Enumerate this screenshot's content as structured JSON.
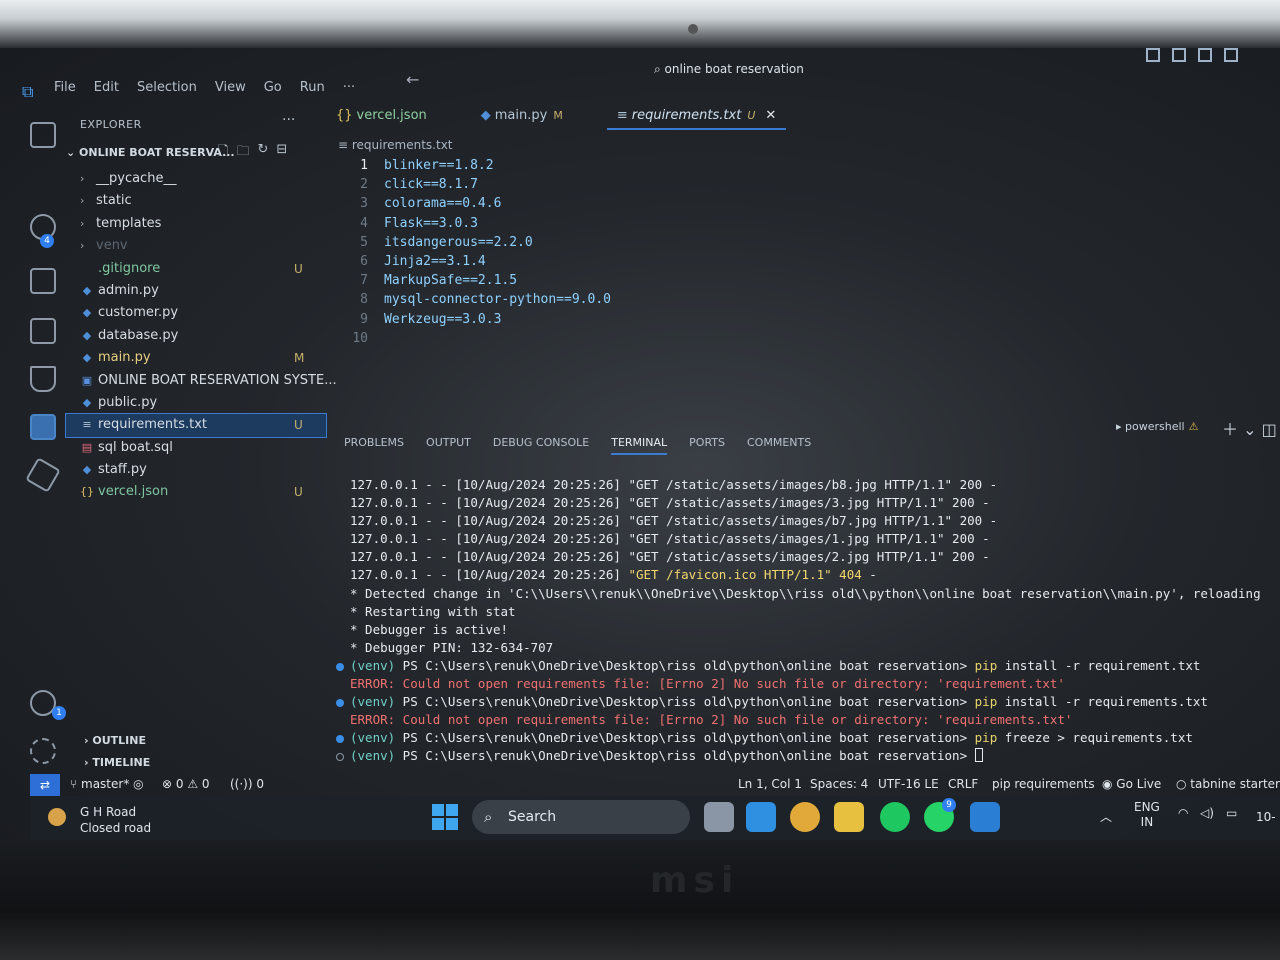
{
  "titlebar": {
    "menu": [
      "File",
      "Edit",
      "Selection",
      "View",
      "Go",
      "Run",
      "···"
    ],
    "command_center": "online boat reservation"
  },
  "explorer": {
    "title": "EXPLORER",
    "dots": "···",
    "root": "ONLINE BOAT RESERVA...",
    "items": [
      {
        "label": "__pycache__",
        "type": "folder",
        "status": ""
      },
      {
        "label": "static",
        "type": "folder",
        "status": ""
      },
      {
        "label": "templates",
        "type": "folder",
        "status": ""
      },
      {
        "label": "venv",
        "type": "folder",
        "status": ""
      },
      {
        "label": ".gitignore",
        "type": "file",
        "status": "U"
      },
      {
        "label": "admin.py",
        "type": "python",
        "status": ""
      },
      {
        "label": "customer.py",
        "type": "python",
        "status": ""
      },
      {
        "label": "database.py",
        "type": "python",
        "status": ""
      },
      {
        "label": "main.py",
        "type": "python",
        "status": "M"
      },
      {
        "label": "ONLINE BOAT RESERVATION SYSTE...",
        "type": "doc",
        "status": ""
      },
      {
        "label": "public.py",
        "type": "python",
        "status": ""
      },
      {
        "label": "requirements.txt",
        "type": "text",
        "status": "U"
      },
      {
        "label": "sql boat.sql",
        "type": "sql",
        "status": ""
      },
      {
        "label": "staff.py",
        "type": "python",
        "status": ""
      },
      {
        "label": "vercel.json",
        "type": "json",
        "status": "U"
      }
    ],
    "outline": "OUTLINE",
    "timeline": "TIMELINE"
  },
  "activity": {
    "scm_badge": "4",
    "accounts_badge": "1"
  },
  "tabs": [
    {
      "label": "vercel.json",
      "icon": "{}",
      "mod": ""
    },
    {
      "label": "main.py",
      "icon": "◆",
      "mod": "M"
    },
    {
      "label": "requirements.txt",
      "icon": "≡",
      "mod": "U"
    }
  ],
  "editor": {
    "breadcrumb": "requirements.txt",
    "lines": [
      "blinker==1.8.2",
      "click==8.1.7",
      "colorama==0.4.6",
      "Flask==3.0.3",
      "itsdangerous==2.2.0",
      "Jinja2==3.1.4",
      "MarkupSafe==2.1.5",
      "mysql-connector-python==9.0.0",
      "Werkzeug==3.0.3",
      ""
    ],
    "line_numbers": [
      "1",
      "2",
      "3",
      "4",
      "5",
      "6",
      "7",
      "8",
      "9",
      "10"
    ]
  },
  "panel": {
    "tabs": [
      "PROBLEMS",
      "OUTPUT",
      "DEBUG CONSOLE",
      "TERMINAL",
      "PORTS",
      "COMMENTS"
    ],
    "active_tab": "TERMINAL",
    "shell": "powershell",
    "plus": "+"
  },
  "terminal": {
    "log_lines": [
      {
        "pre": "127.0.0.1 - - [10/Aug/2024 20:25:26] \"GET /static/assets/images/b8.jpg HTTP/1.1\" 200 -"
      },
      {
        "pre": "127.0.0.1 - - [10/Aug/2024 20:25:26] \"GET /static/assets/images/3.jpg HTTP/1.1\" 200 -"
      },
      {
        "pre": "127.0.0.1 - - [10/Aug/2024 20:25:26] \"GET /static/assets/images/b7.jpg HTTP/1.1\" 200 -"
      },
      {
        "pre": "127.0.0.1 - - [10/Aug/2024 20:25:26] \"GET /static/assets/images/1.jpg HTTP/1.1\" 200 -"
      },
      {
        "pre": "127.0.0.1 - - [10/Aug/2024 20:25:26] \"GET /static/assets/images/2.jpg HTTP/1.1\" 200 -"
      }
    ],
    "favicon_prefix": "127.0.0.1 - - [10/Aug/2024 20:25:26] ",
    "favicon_hl": "\"GET /favicon.ico HTTP/1.1\" 404",
    "favicon_suffix": " -",
    "info_lines": [
      " * Detected change in 'C:\\\\Users\\\\renuk\\\\OneDrive\\\\Desktop\\\\riss  old\\\\python\\\\online boat reservation\\\\main.py', reloading",
      " * Restarting with stat",
      " * Debugger is active!",
      " * Debugger PIN: 132-634-707"
    ],
    "venv": "(venv)",
    "prompt": " PS C:\\Users\\renuk\\OneDrive\\Desktop\\riss  old\\python\\online boat reservation> ",
    "cmd1_pip": "pip",
    "cmd1_rest": " install -r requirement.txt",
    "err1": "ERROR: Could not open requirements file: [Errno 2] No such file or directory: 'requirement.txt'",
    "cmd2_pip": "pip",
    "cmd2_rest": " install -r requirements.txt",
    "err2": "ERROR: Could not open requirements file: [Errno 2] No such file or directory: 'requirements.txt'",
    "cmd3_pip": "pip",
    "cmd3_rest": " freeze > requirements.txt"
  },
  "statusbar": {
    "branch": "master*",
    "errors": "⊗ 0 ⚠ 0",
    "ports": "0",
    "position": "Ln 1, Col 1",
    "spaces": "Spaces: 4",
    "encoding": "UTF-16 LE",
    "eol": "CRLF",
    "language": "pip requirements",
    "golive": "Go Live",
    "tabnine": "tabnine starter"
  },
  "taskbar": {
    "weather_line1": "G H Road",
    "weather_line2": "Closed road",
    "search": "Search",
    "lang1": "ENG",
    "lang2": "IN",
    "clock": "10-",
    "whatsapp_badge": "9"
  },
  "chin": {
    "logo": "msi"
  }
}
